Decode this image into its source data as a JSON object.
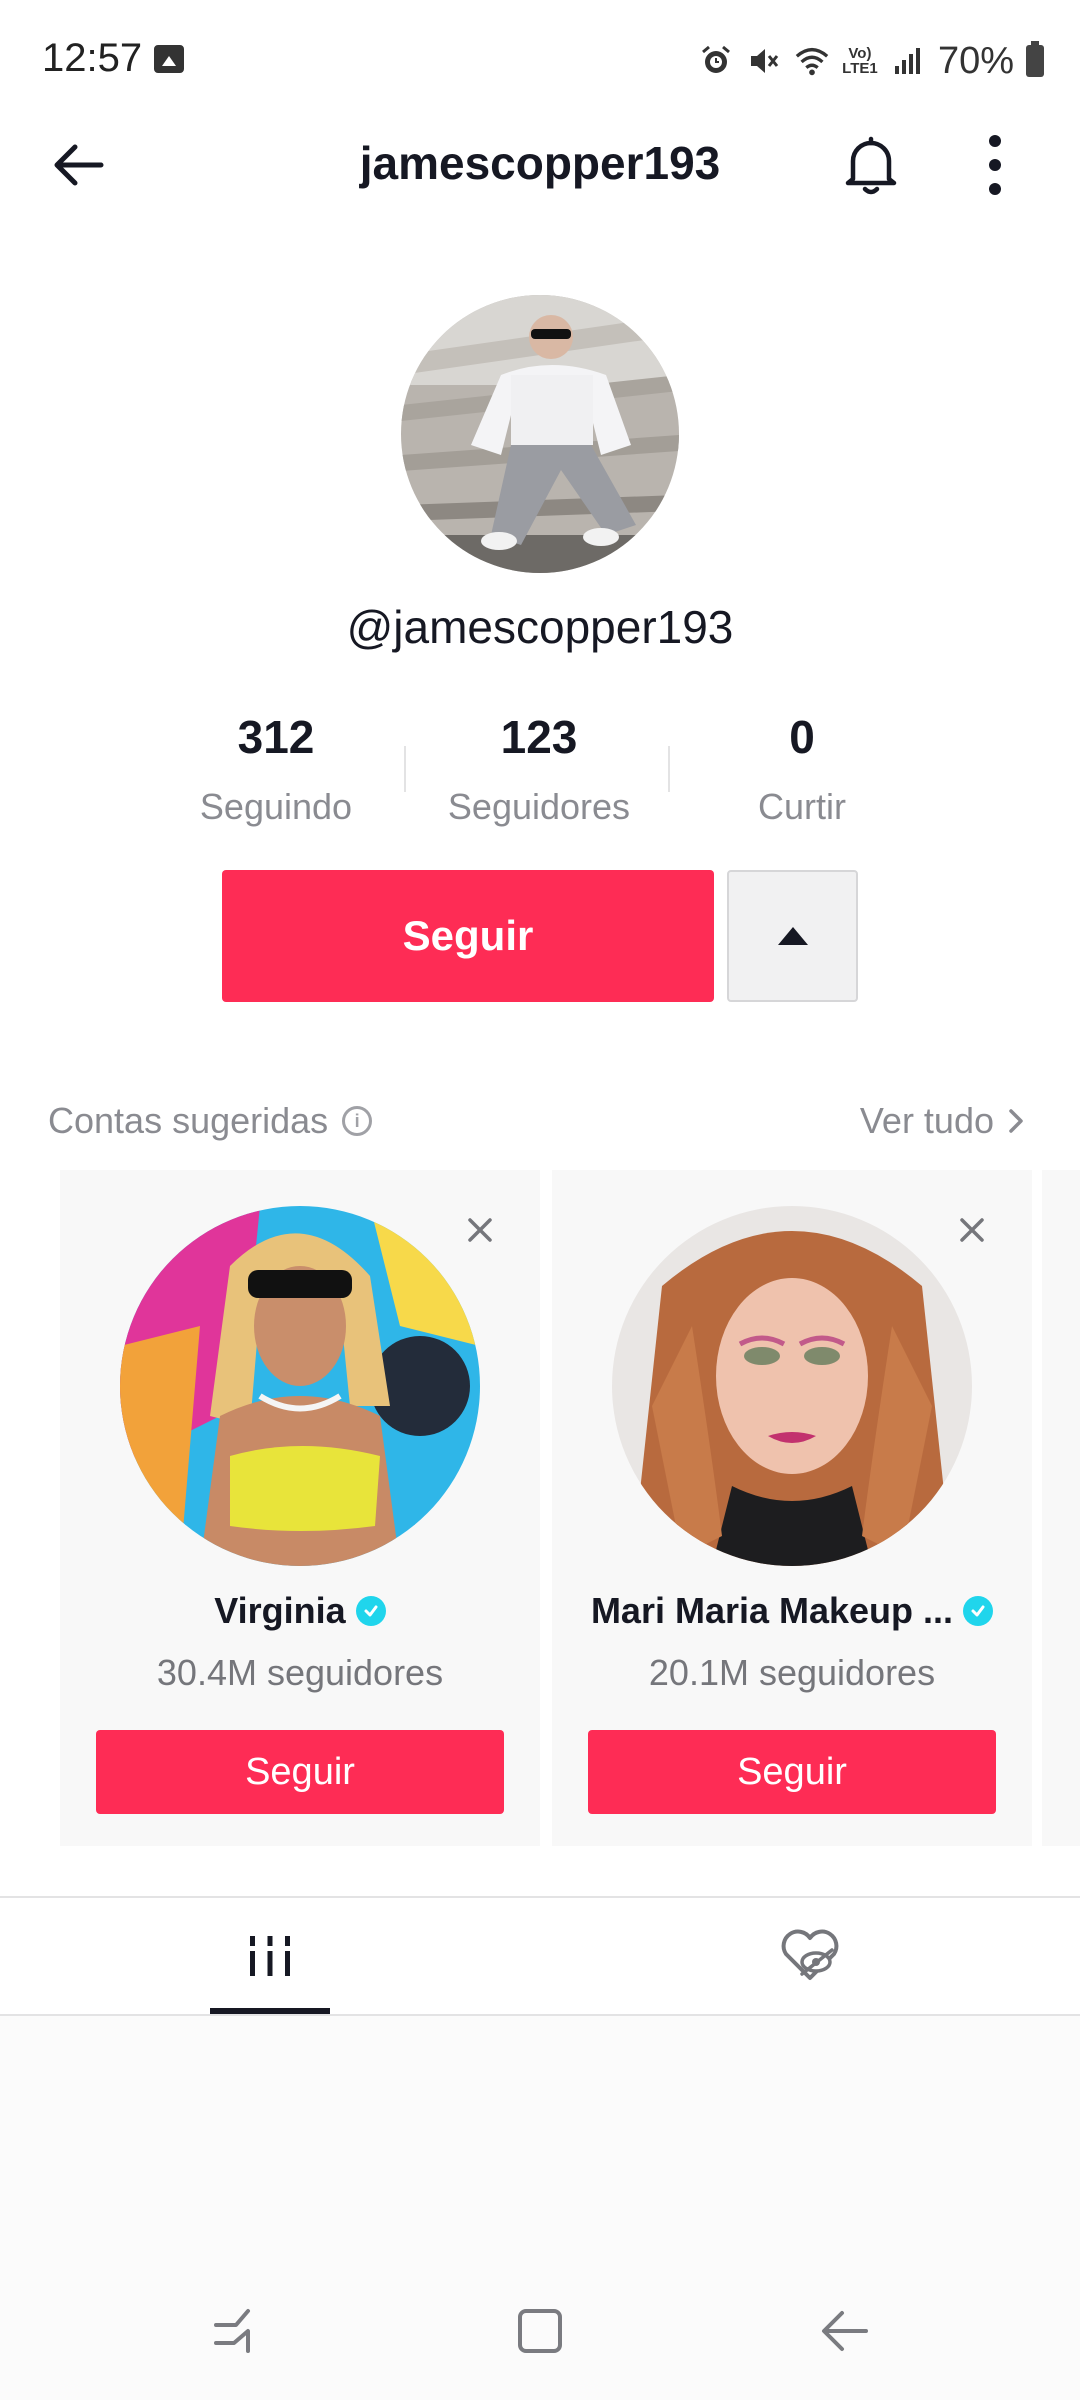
{
  "status_bar": {
    "time": "12:57",
    "volte_line1": "Vo)",
    "volte_line2": "LTE1",
    "battery": "70%"
  },
  "header": {
    "title": "jamescopper193",
    "icons": [
      "back-arrow-icon",
      "bell-icon",
      "more-vertical-icon"
    ]
  },
  "profile": {
    "handle": "@jamescopper193",
    "stats": [
      {
        "value": "312",
        "label": "Seguindo"
      },
      {
        "value": "123",
        "label": "Seguidores"
      },
      {
        "value": "0",
        "label": "Curtir"
      }
    ],
    "follow_label": "Seguir"
  },
  "suggested": {
    "title": "Contas sugeridas",
    "see_all": "Ver tudo",
    "accounts": [
      {
        "name": "Virginia",
        "followers": "30.4M seguidores",
        "follow_label": "Seguir",
        "verified": true
      },
      {
        "name": "Mari Maria Makeup ...",
        "followers": "20.1M seguidores",
        "follow_label": "Seguir",
        "verified": true
      }
    ]
  },
  "tabs": [
    {
      "icon": "videos-grid-icon",
      "active": true
    },
    {
      "icon": "liked-hidden-icon",
      "active": false
    }
  ],
  "colors": {
    "accent": "#fe2c55",
    "verified": "#20d5ec",
    "text_primary": "#161823",
    "text_secondary": "#8a8b91"
  }
}
